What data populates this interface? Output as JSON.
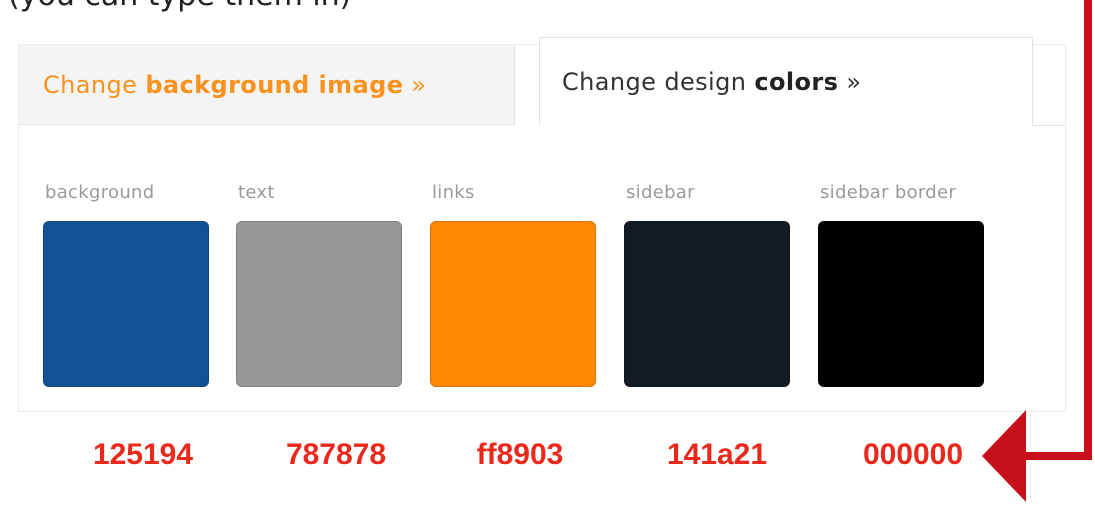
{
  "caption": "(you can type them in)",
  "tabs": {
    "background": {
      "prefix": "Change ",
      "bold": "background image",
      "suffix": " »"
    },
    "colors": {
      "prefix": "Change design ",
      "bold": "colors",
      "suffix": " »"
    }
  },
  "swatches": [
    {
      "label": "background",
      "color": "#125194",
      "hex": "125194"
    },
    {
      "label": "text",
      "color": "#979797",
      "hex": "787878"
    },
    {
      "label": "links",
      "color": "#ff8903",
      "hex": "ff8903"
    },
    {
      "label": "sidebar",
      "color": "#141a21",
      "hex": "141a21"
    },
    {
      "label": "sidebar border",
      "color": "#000000",
      "hex": "000000"
    }
  ],
  "annotation": {
    "arrow_color": "#c8101a",
    "arrow_icon": "arrow-left-icon"
  }
}
